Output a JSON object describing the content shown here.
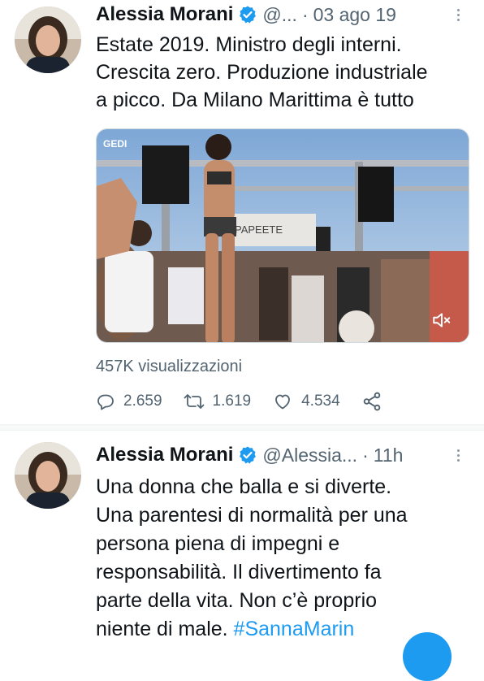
{
  "tweets": [
    {
      "author": "Alessia Morani",
      "handle": "@...",
      "separator": "·",
      "time": "03 ago 19",
      "text": "Estate 2019. Ministro degli interni.\nCrescita zero. Produzione industriale\na picco. Da Milano Marittima è tutto",
      "media": {
        "watermark": "GEDI",
        "sign_text": "PAPEETE",
        "mute_icon": "speaker-muted-icon"
      },
      "views": "457K visualizzazioni",
      "stats": {
        "replies": "2.659",
        "retweets": "1.619",
        "likes": "4.534"
      }
    },
    {
      "author": "Alessia Morani",
      "handle": "@Alessia...",
      "separator": "·",
      "time": "11h",
      "text": "Una donna che balla e si diverte.\nUna parentesi di normalità per una\npersona piena di impegni e\nresponsabilità. Il divertimento fa\nparte della vita. Non c’è proprio\nniente di male. ",
      "hashtag": "#SannaMarin"
    }
  ],
  "icons": {
    "verified": "verified-badge-icon",
    "more": "more-options-icon",
    "reply": "reply-icon",
    "retweet": "retweet-icon",
    "like": "heart-icon",
    "share": "share-icon"
  },
  "colors": {
    "accent": "#1d9bf0",
    "text": "#0f1419",
    "secondary": "#536471"
  }
}
